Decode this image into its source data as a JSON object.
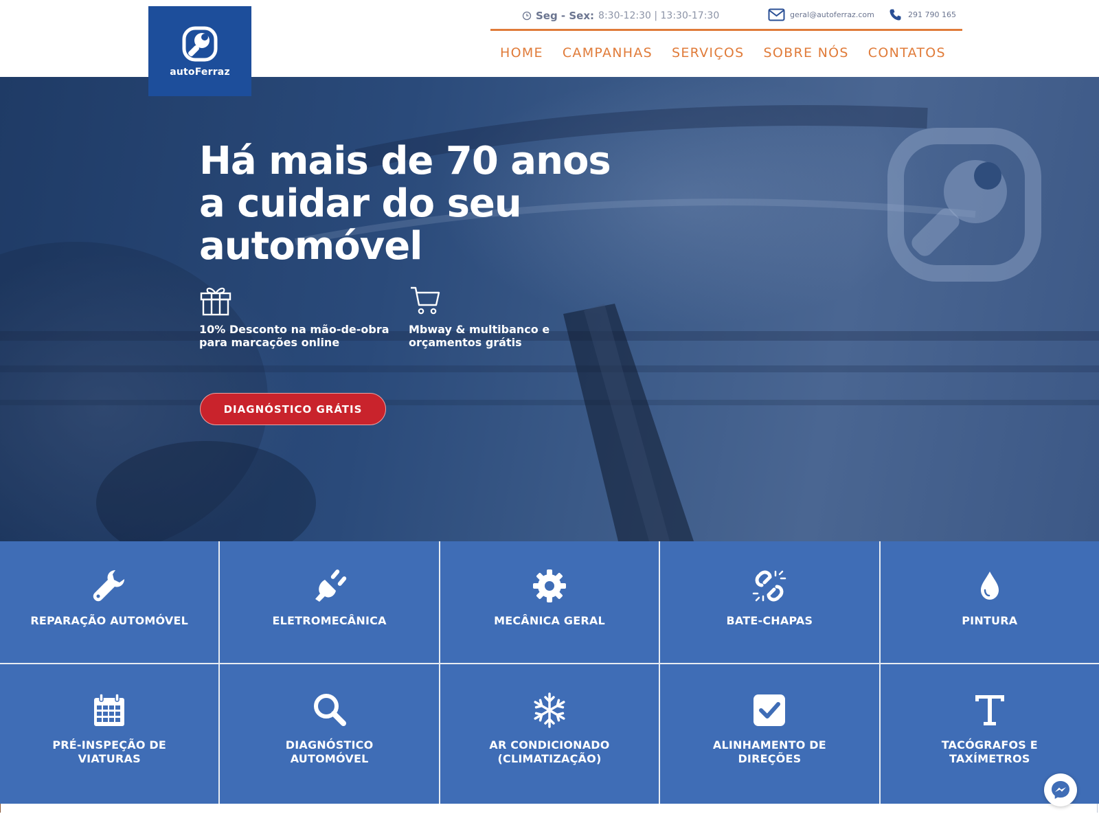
{
  "brand": {
    "name": "autoFerraz"
  },
  "topbar": {
    "hours_label": "Seg - Sex:",
    "hours_value": "8:30-12:30 | 13:30-17:30",
    "email": "geral@autoferraz.com",
    "phone": "291 790 165"
  },
  "nav": {
    "items": [
      {
        "label": "HOME"
      },
      {
        "label": "CAMPANHAS"
      },
      {
        "label": "SERVIÇOS"
      },
      {
        "label": "SOBRE NÓS"
      },
      {
        "label": "CONTATOS"
      }
    ]
  },
  "hero": {
    "title": "Há mais de 70 anos a cuidar do seu automóvel",
    "features": [
      {
        "icon": "gift-icon",
        "text": "10% Desconto na mão-de-obra para marcações online"
      },
      {
        "icon": "cart-icon",
        "text": "Mbway & multibanco e orçamentos grátis"
      }
    ],
    "cta_label": "DIAGNÓSTICO GRÁTIS"
  },
  "services": [
    {
      "icon": "wrench-icon",
      "label": "REPARAÇÃO AUTOMÓVEL"
    },
    {
      "icon": "plug-icon",
      "label": "ELETROMECÂNICA"
    },
    {
      "icon": "gear-icon",
      "label": "MECÂNICA GERAL"
    },
    {
      "icon": "broken-link-icon",
      "label": "BATE-CHAPAS"
    },
    {
      "icon": "drop-icon",
      "label": "PINTURA"
    },
    {
      "icon": "calendar-icon",
      "label": "PRÉ-INSPEÇÃO DE\nVIATURAS"
    },
    {
      "icon": "search-icon",
      "label": "DIAGNÓSTICO\nAUTOMÓVEL"
    },
    {
      "icon": "snowflake-icon",
      "label": "AR CONDICIONADO\n(CLIMATIZAÇÃO)"
    },
    {
      "icon": "checkbox-icon",
      "label": "ALINHAMENTO DE\nDIREÇÕES"
    },
    {
      "icon": "text-icon",
      "label": "TACÓGRAFOS E\nTAXÍMETROS"
    }
  ],
  "colors": {
    "brand_blue": "#1d4e9b",
    "service_blue": "#3f6db6",
    "accent_orange": "#e07b39",
    "cta_red": "#c9232c"
  }
}
